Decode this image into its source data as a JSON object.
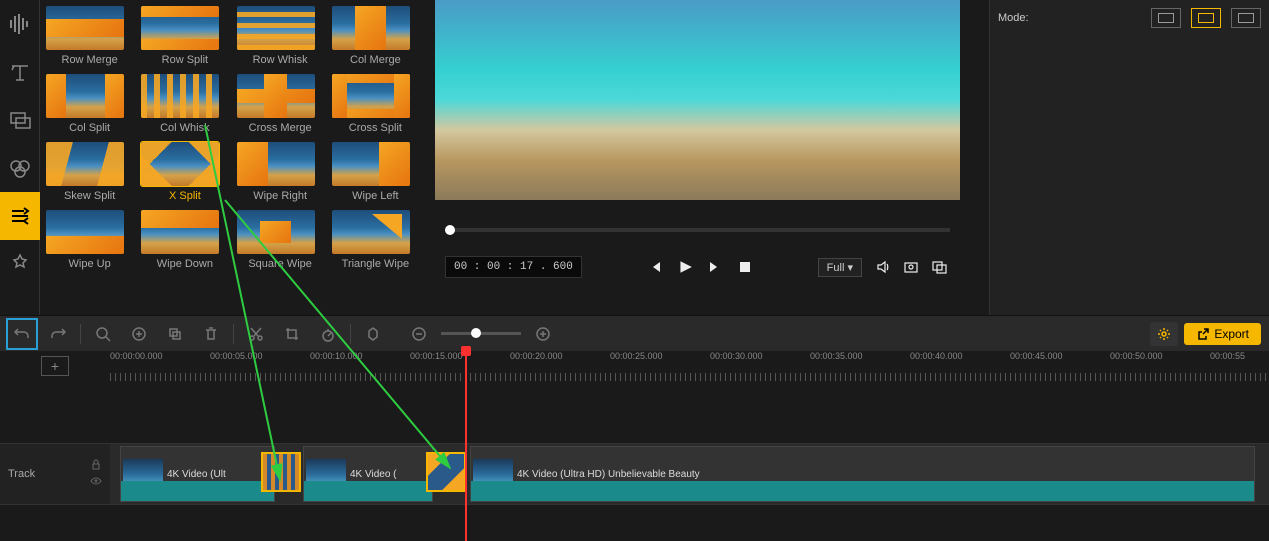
{
  "toolbar": {
    "tools": [
      "audio",
      "text",
      "overlay",
      "color",
      "transitions",
      "effects"
    ]
  },
  "transitions": {
    "items": [
      {
        "id": "row-merge",
        "label": "Row Merge"
      },
      {
        "id": "row-split",
        "label": "Row Split"
      },
      {
        "id": "row-whisk",
        "label": "Row Whisk"
      },
      {
        "id": "col-merge",
        "label": "Col Merge"
      },
      {
        "id": "col-split",
        "label": "Col Split"
      },
      {
        "id": "col-whisk",
        "label": "Col Whisk"
      },
      {
        "id": "cross-merge",
        "label": "Cross Merge"
      },
      {
        "id": "cross-split",
        "label": "Cross Split"
      },
      {
        "id": "skew-split",
        "label": "Skew Split"
      },
      {
        "id": "x-split",
        "label": "X Split",
        "selected": true
      },
      {
        "id": "wipe-right",
        "label": "Wipe Right"
      },
      {
        "id": "wipe-left",
        "label": "Wipe Left"
      },
      {
        "id": "wipe-up",
        "label": "Wipe Up"
      },
      {
        "id": "wipe-down",
        "label": "Wipe Down"
      },
      {
        "id": "square-wipe",
        "label": "Square Wipe"
      },
      {
        "id": "triangle-wipe",
        "label": "Triangle Wipe"
      }
    ]
  },
  "preview": {
    "timecode": "00 : 00 : 17 . 600",
    "scale_label": "Full"
  },
  "properties": {
    "mode_label": "Mode:"
  },
  "toolbar_row": {
    "export_label": "Export"
  },
  "timeline": {
    "ruler": [
      "00:00:00.000",
      "00:00:05.000",
      "00:00:10.000",
      "00:00:15.000",
      "00:00:20.000",
      "00:00:25.000",
      "00:00:30.000",
      "00:00:35.000",
      "00:00:40.000",
      "00:00:45.000",
      "00:00:50.000",
      "00:00:55"
    ],
    "track_label": "Track",
    "clips": [
      {
        "label": "4K Video (Ult"
      },
      {
        "label": "4K Video ("
      },
      {
        "label": "4K Video (Ultra HD) Unbelievable Beauty"
      }
    ]
  }
}
